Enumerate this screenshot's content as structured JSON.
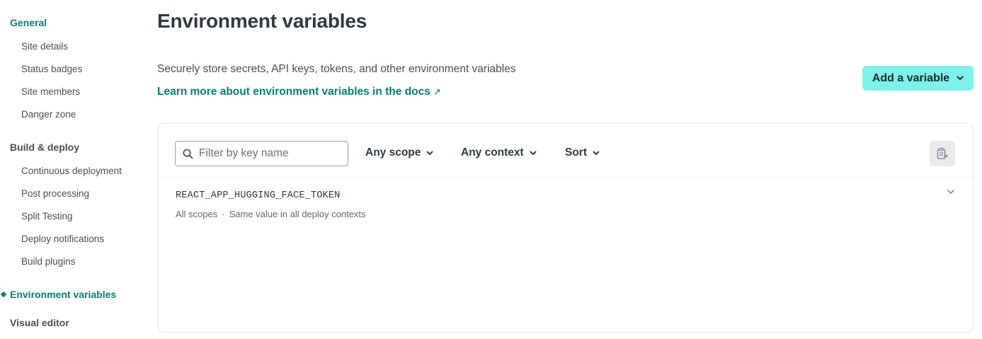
{
  "sidebar": {
    "general_label": "General",
    "general_items": [
      "Site details",
      "Status badges",
      "Site members",
      "Danger zone"
    ],
    "build_label": "Build & deploy",
    "build_items": [
      "Continuous deployment",
      "Post processing",
      "Split Testing",
      "Deploy notifications",
      "Build plugins"
    ],
    "current_label": "Environment variables",
    "visual_editor_label": "Visual editor"
  },
  "main": {
    "title": "Environment variables",
    "description": "Securely store secrets, API keys, tokens, and other environment variables",
    "docs_link": "Learn more about environment variables in the docs",
    "docs_link_icon": "↗",
    "add_button_label": "Add a variable"
  },
  "toolbar": {
    "filter_placeholder": "Filter by key name",
    "filter_value": "",
    "scope_label": "Any scope",
    "context_label": "Any context",
    "sort_label": "Sort"
  },
  "variables": [
    {
      "key": "REACT_APP_HUGGING_FACE_TOKEN",
      "scope": "All scopes",
      "separator": "·",
      "contexts": "Same value in all deploy contexts"
    }
  ],
  "colors": {
    "accent": "#087e72",
    "button_bg": "#7ef2e9",
    "text": "#2d3b41",
    "muted": "#5f6770"
  },
  "icons": {
    "search": "search-icon",
    "chevron": "chevron-down-icon",
    "copy": "clipboard-icon",
    "external": "external-link-icon"
  }
}
